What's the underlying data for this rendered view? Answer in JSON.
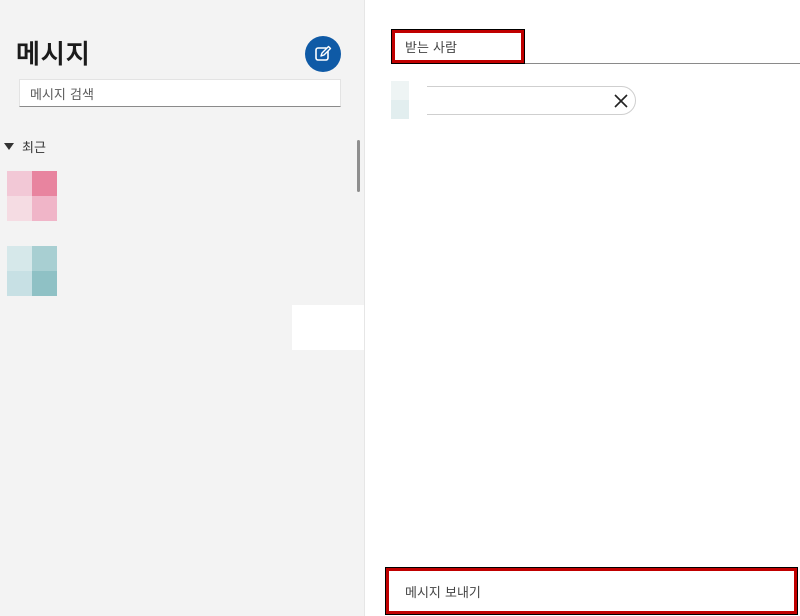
{
  "sidebar": {
    "title": "메시지",
    "compose_icon": "compose-icon",
    "search": {
      "placeholder": "메시지 검색"
    },
    "section": {
      "label": "최근",
      "icon": "triangle-down-icon"
    },
    "conversations": [
      {
        "avatar_colors": [
          "#f2c8d6",
          "#e8849f",
          "#f5dce3",
          "#f0b5c8"
        ]
      },
      {
        "avatar_colors": [
          "#d6e8ea",
          "#a8cfd2",
          "#c7e0e4",
          "#8fc1c5"
        ]
      }
    ]
  },
  "main": {
    "to_field": {
      "placeholder": "받는 사람"
    },
    "recipient_chip": {
      "remove_icon": "close-icon",
      "avatar_colors": [
        "#eef4f4",
        "#ffffff",
        "#e2eeef",
        "#ffffff"
      ]
    },
    "message_input": {
      "placeholder": "메시지 보내기"
    }
  },
  "colors": {
    "accent": "#0f5aa6",
    "highlight": "#c00000",
    "sidebar_bg": "#f3f3f3"
  }
}
